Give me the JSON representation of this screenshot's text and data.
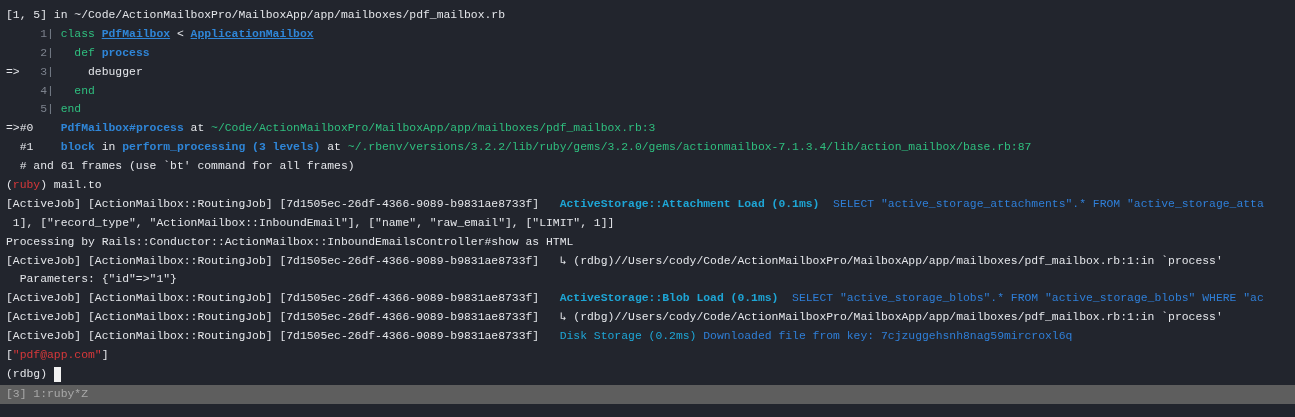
{
  "terminal": {
    "lines": [
      {
        "segments": [
          {
            "text": "[1, 5] in ~/Code/ActionMailboxPro/MailboxApp/app/mailboxes/pdf_mailbox.rb",
            "kind": "plain"
          }
        ]
      },
      {
        "segments": [
          {
            "text": "     1| ",
            "kind": "gutter"
          },
          {
            "text": "class ",
            "kind": "keyword"
          },
          {
            "text": "PdfMailbox",
            "kind": "link"
          },
          {
            "text": " < ",
            "kind": "plain"
          },
          {
            "text": "ApplicationMailbox",
            "kind": "link"
          }
        ]
      },
      {
        "segments": [
          {
            "text": "     2| ",
            "kind": "gutter"
          },
          {
            "text": "  def ",
            "kind": "keyword"
          },
          {
            "text": "process",
            "kind": "method"
          }
        ]
      },
      {
        "segments": [
          {
            "text": "=>",
            "kind": "plain"
          },
          {
            "text": "   3| ",
            "kind": "gutter"
          },
          {
            "text": "    debugger",
            "kind": "plain"
          }
        ]
      },
      {
        "segments": [
          {
            "text": "     4| ",
            "kind": "gutter"
          },
          {
            "text": "  end",
            "kind": "keyword"
          }
        ]
      },
      {
        "segments": [
          {
            "text": "     5| ",
            "kind": "gutter"
          },
          {
            "text": "end",
            "kind": "keyword"
          }
        ]
      },
      {
        "segments": [
          {
            "text": "=>#0    ",
            "kind": "plain"
          },
          {
            "text": "PdfMailbox#process",
            "kind": "method"
          },
          {
            "text": " at ",
            "kind": "plain"
          },
          {
            "text": "~/Code/ActionMailboxPro/MailboxApp/app/mailboxes/pdf_mailbox.rb:3",
            "kind": "path"
          }
        ]
      },
      {
        "segments": [
          {
            "text": "  #1    ",
            "kind": "plain"
          },
          {
            "text": "block",
            "kind": "method"
          },
          {
            "text": " in ",
            "kind": "plain"
          },
          {
            "text": "perform_processing (3 levels)",
            "kind": "method"
          },
          {
            "text": " at ",
            "kind": "plain"
          },
          {
            "text": "~/.rbenv/versions/3.2.2/lib/ruby/gems/3.2.0/gems/actionmailbox-7.1.3.4/lib/action_mailbox/base.rb:87",
            "kind": "path"
          }
        ]
      },
      {
        "segments": [
          {
            "text": "  # and 61 frames (use `bt' command for all frames)",
            "kind": "plain"
          }
        ]
      },
      {
        "segments": [
          {
            "text": "(",
            "kind": "plain"
          },
          {
            "text": "ruby",
            "kind": "error"
          },
          {
            "text": ") mail.to",
            "kind": "plain"
          }
        ]
      },
      {
        "segments": [
          {
            "text": "[ActiveJob] [ActionMailbox::RoutingJob] [7d1505ec-26df-4366-9089-b9831ae8733f]   ",
            "kind": "plain"
          },
          {
            "text": "ActiveStorage::Attachment Load (0.1ms)",
            "kind": "log"
          },
          {
            "text": "  SELECT \"active_storage_attachments\".* FROM \"active_storage_atta",
            "kind": "sql"
          }
        ]
      },
      {
        "segments": [
          {
            "text": " 1], [\"record_type\", \"ActionMailbox::InboundEmail\"], [\"name\", \"raw_email\"], [\"LIMIT\", 1]]",
            "kind": "plain"
          }
        ]
      },
      {
        "segments": [
          {
            "text": "Processing by Rails::Conductor::ActionMailbox::InboundEmailsController#show as HTML",
            "kind": "plain"
          }
        ]
      },
      {
        "segments": [
          {
            "text": "[ActiveJob] [ActionMailbox::RoutingJob] [7d1505ec-26df-4366-9089-b9831ae8733f]   ↳ (rdbg)//Users/cody/Code/ActionMailboxPro/MailboxApp/app/mailboxes/pdf_mailbox.rb:1:in `process'",
            "kind": "plain"
          }
        ]
      },
      {
        "segments": [
          {
            "text": "  Parameters: {\"id\"=>\"1\"}",
            "kind": "plain"
          }
        ]
      },
      {
        "segments": [
          {
            "text": "[ActiveJob] [ActionMailbox::RoutingJob] [7d1505ec-26df-4366-9089-b9831ae8733f]   ",
            "kind": "plain"
          },
          {
            "text": "ActiveStorage::Blob Load (0.1ms)",
            "kind": "log"
          },
          {
            "text": "  SELECT \"active_storage_blobs\".* FROM \"active_storage_blobs\" WHERE \"ac",
            "kind": "sql"
          }
        ]
      },
      {
        "segments": [
          {
            "text": "[ActiveJob] [ActionMailbox::RoutingJob] [7d1505ec-26df-4366-9089-b9831ae8733f]   ↳ (rdbg)//Users/cody/Code/ActionMailboxPro/MailboxApp/app/mailboxes/pdf_mailbox.rb:1:in `process'",
            "kind": "plain"
          }
        ]
      },
      {
        "segments": [
          {
            "text": "[ActiveJob] [ActionMailbox::RoutingJob] [7d1505ec-26df-4366-9089-b9831ae8733f]   ",
            "kind": "plain"
          },
          {
            "text": "Disk Storage (0.2ms)",
            "kind": "timing"
          },
          {
            "text": " Downloaded file from key: 7cjzuggehsnh8nag59mircroxl6q",
            "kind": "sql"
          }
        ]
      },
      {
        "segments": [
          {
            "text": "[",
            "kind": "plain"
          },
          {
            "text": "\"pdf@app.com\"",
            "kind": "error"
          },
          {
            "text": "]",
            "kind": "plain"
          }
        ]
      },
      {
        "segments": [
          {
            "text": "(rdbg) ",
            "kind": "plain"
          }
        ],
        "cursor": true
      }
    ]
  },
  "status_bar": {
    "text": "[3] 1:ruby*Z"
  }
}
